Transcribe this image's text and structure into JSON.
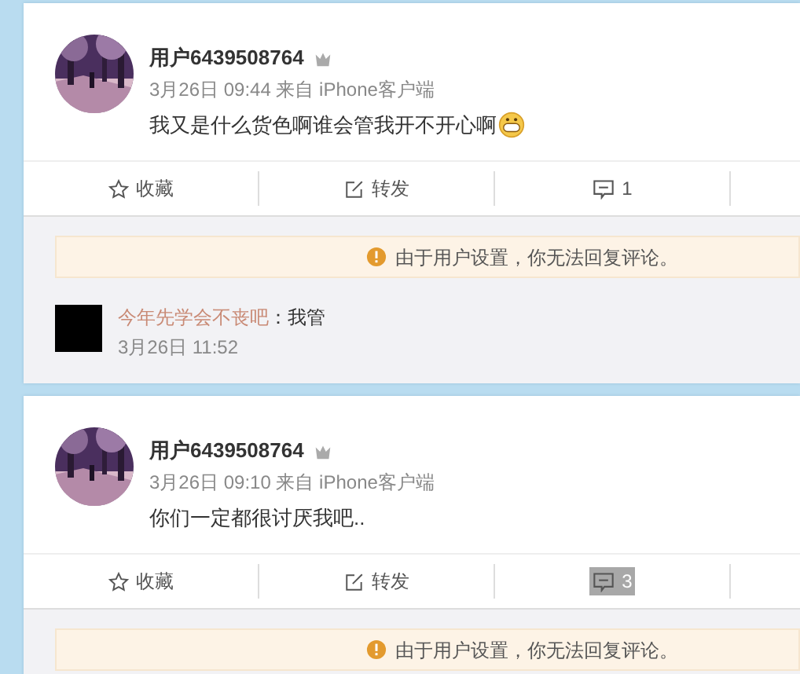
{
  "posts": [
    {
      "user": {
        "name": "用户6439508764"
      },
      "meta": "3月26日 09:44 来自 iPhone客户端",
      "text": "我又是什么货色啊谁会管我开不开心啊",
      "has_emoji": true,
      "actions": [
        {
          "kind": "favorite",
          "label": "收藏",
          "selected": false
        },
        {
          "kind": "repost",
          "label": "转发",
          "selected": false
        },
        {
          "kind": "comment",
          "label": "1",
          "selected": false
        }
      ],
      "notice": "由于用户设置，你无法回复评论。",
      "comments": [
        {
          "user": "今年先学会不丧吧",
          "text": "：我管",
          "time": "3月26日 11:52"
        }
      ]
    },
    {
      "user": {
        "name": "用户6439508764"
      },
      "meta": "3月26日 09:10 来自 iPhone客户端",
      "text": "你们一定都很讨厌我吧..",
      "has_emoji": false,
      "actions": [
        {
          "kind": "favorite",
          "label": "收藏",
          "selected": false
        },
        {
          "kind": "repost",
          "label": "转发",
          "selected": false
        },
        {
          "kind": "comment",
          "label": "3",
          "selected": true
        }
      ],
      "notice": "由于用户设置，你无法回复评论。"
    }
  ]
}
